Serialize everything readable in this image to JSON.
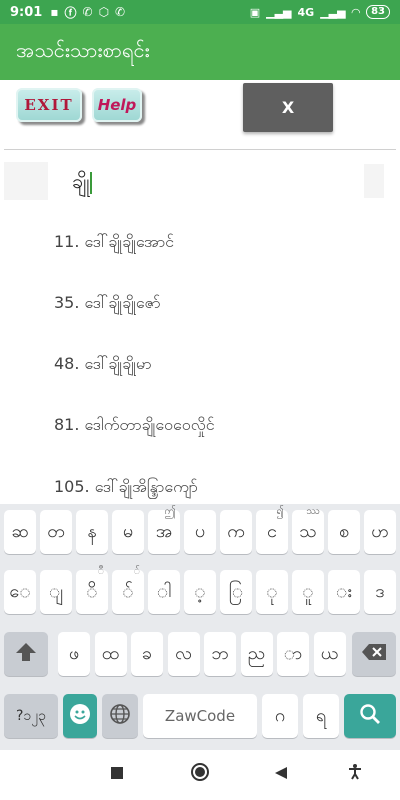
{
  "status_bar": {
    "time": "9:01",
    "battery": "83",
    "network": "4G"
  },
  "app_title": "အသင်းသားစာရင်း",
  "toolbar": {
    "exit_label": "EXIT",
    "help_label": "Help",
    "close_label": "X"
  },
  "search": {
    "value": "ချို"
  },
  "results": [
    "11. ဒေါ်ချိုချိုအောင်",
    "35. ဒေါ်ချိုချိုဇော်",
    "48. ဒေါ်ချိုချိုမာ",
    "81. ဒေါက်တာချိုဝေဝေလှိုင်",
    "105. ဒေါ်ချိုအိန္ဒြာကျော်"
  ],
  "keyboard": {
    "row1": [
      {
        "k": "ဆ",
        "sup": ""
      },
      {
        "k": "တ",
        "sup": ""
      },
      {
        "k": "န",
        "sup": ""
      },
      {
        "k": "မ",
        "sup": ""
      },
      {
        "k": "အ",
        "sup": "ဤ"
      },
      {
        "k": "ပ",
        "sup": ""
      },
      {
        "k": "က",
        "sup": ""
      },
      {
        "k": "င",
        "sup": "၍"
      },
      {
        "k": "သ",
        "sup": "ဿ"
      },
      {
        "k": "စ",
        "sup": ""
      },
      {
        "k": "ဟ",
        "sup": ""
      }
    ],
    "row2": [
      {
        "k": "ေ",
        "sup": ""
      },
      {
        "k": "ျ",
        "sup": ""
      },
      {
        "k": "ိ",
        "sup": "ီ"
      },
      {
        "k": "်",
        "sup": "ၲ"
      },
      {
        "k": "ါ",
        "sup": ""
      },
      {
        "k": "့",
        "sup": ""
      },
      {
        "k": "ြ",
        "sup": ""
      },
      {
        "k": "ု",
        "sup": ""
      },
      {
        "k": "ူ",
        "sup": ""
      },
      {
        "k": "း",
        "sup": ""
      },
      {
        "k": "ဒ",
        "sup": ""
      }
    ],
    "row3": [
      "ဖ",
      "ထ",
      "ခ",
      "လ",
      "ဘ",
      "ည",
      "ာ",
      "ယ"
    ],
    "symbols_label": "?၁၂၃",
    "space_label": "ZawCode",
    "key_ga": "ဂ",
    "key_ra": "ရ"
  },
  "icons": {
    "shift": "shift-icon",
    "backspace": "backspace-icon",
    "emoji": "emoji-icon",
    "globe": "globe-icon",
    "search": "search-icon"
  },
  "colors": {
    "status_bar": "#3da550",
    "app_bar": "#4caf50",
    "teal": "#3aa69a",
    "close_button": "#5f5f5f"
  }
}
